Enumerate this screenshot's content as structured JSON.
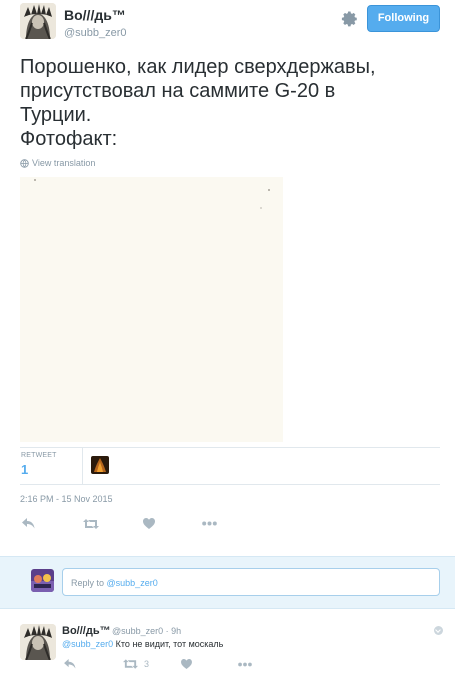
{
  "header": {
    "name": "Во///дь™",
    "handle": "@subb_zer0",
    "follow_label": "Following"
  },
  "tweet": {
    "lines": [
      "Порошенко, как лидер сверхдержавы,",
      "присутствовал на саммите G-20 в",
      "Турции.",
      "Фотофакт:"
    ],
    "translate_label": "View translation",
    "retweet_label": "RETWEET",
    "retweet_count": "1",
    "timestamp": "2:16 PM - 15 Nov 2015"
  },
  "reply_box": {
    "prefix": "Reply to ",
    "mention": "@subb_zer0"
  },
  "comment": {
    "name": "Во///дь™",
    "meta": "@subb_zer0 · 9h",
    "mention": "@subb_zer0",
    "text": " Кто не видит, тот москаль",
    "retweet_count": "3"
  },
  "colors": {
    "accent": "#55acee",
    "muted": "#8899a6",
    "icon": "#aab8c2",
    "reply_band": "#e8f4fb"
  },
  "icons": [
    "gear-icon",
    "globe-icon",
    "reply-icon",
    "retweet-icon",
    "heart-icon",
    "more-icon"
  ]
}
